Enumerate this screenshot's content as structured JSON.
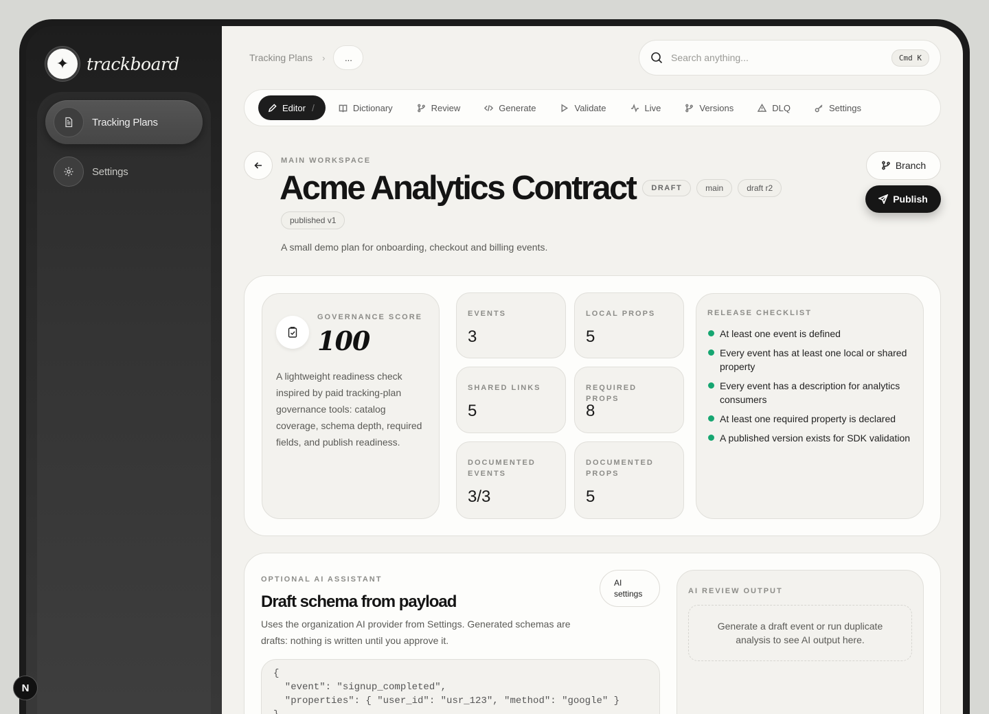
{
  "brand": {
    "name": "trackboard"
  },
  "sidebar": {
    "items": [
      {
        "label": "Tracking Plans",
        "icon": "document-icon",
        "active": true
      },
      {
        "label": "Settings",
        "icon": "gear-icon",
        "active": false
      }
    ]
  },
  "next_badge": "N",
  "breadcrumb": {
    "root": "Tracking Plans",
    "separator": "›",
    "more": "..."
  },
  "search": {
    "placeholder": "Search anything...",
    "shortcut": "Cmd K"
  },
  "tabs": [
    {
      "label": "Editor",
      "icon": "pencil-icon",
      "active": true
    },
    {
      "label": "Dictionary",
      "icon": "book-icon"
    },
    {
      "label": "Review",
      "icon": "branch-icon"
    },
    {
      "label": "Generate",
      "icon": "code-icon"
    },
    {
      "label": "Validate",
      "icon": "play-icon"
    },
    {
      "label": "Live",
      "icon": "activity-icon"
    },
    {
      "label": "Versions",
      "icon": "branch-icon"
    },
    {
      "label": "DLQ",
      "icon": "warning-icon"
    },
    {
      "label": "Settings",
      "icon": "key-icon"
    }
  ],
  "header": {
    "workspace": "MAIN WORKSPACE",
    "title": "Acme Analytics Contract",
    "status": "DRAFT",
    "branch": "main",
    "draft": "draft r2",
    "published": "published v1",
    "description": "A small demo plan for onboarding, checkout and billing events.",
    "branch_button": "Branch",
    "publish_button": "Publish"
  },
  "governance": {
    "label": "GOVERNANCE SCORE",
    "score": "100",
    "description": "A lightweight readiness check inspired by paid tracking-plan governance tools: catalog coverage, schema depth, required fields, and publish readiness."
  },
  "metrics": [
    {
      "label": "EVENTS",
      "value": "3"
    },
    {
      "label": "LOCAL PROPS",
      "value": "5"
    },
    {
      "label": "SHARED LINKS",
      "value": "5"
    },
    {
      "label": "REQUIRED PROPS",
      "value": "8"
    },
    {
      "label": "DOCUMENTED EVENTS",
      "value": "3/3"
    },
    {
      "label": "DOCUMENTED PROPS",
      "value": "5"
    }
  ],
  "checklist": {
    "label": "RELEASE CHECKLIST",
    "status_color": "#16a671",
    "items": [
      "At least one event is defined",
      "Every event has at least one local or shared property",
      "Every event has a description for analytics consumers",
      "At least one required property is declared",
      "A published version exists for SDK validation"
    ]
  },
  "ai": {
    "label": "OPTIONAL AI ASSISTANT",
    "title": "Draft schema from payload",
    "description": "Uses the organization AI provider from Settings. Generated schemas are drafts: nothing is written until you approve it.",
    "settings_button": "AI settings",
    "payload": "{\n  \"event\": \"signup_completed\",\n  \"properties\": { \"user_id\": \"usr_123\", \"method\": \"google\" }\n}",
    "review_label": "AI REVIEW OUTPUT",
    "review_empty": "Generate a draft event or run duplicate analysis to see AI output here."
  }
}
